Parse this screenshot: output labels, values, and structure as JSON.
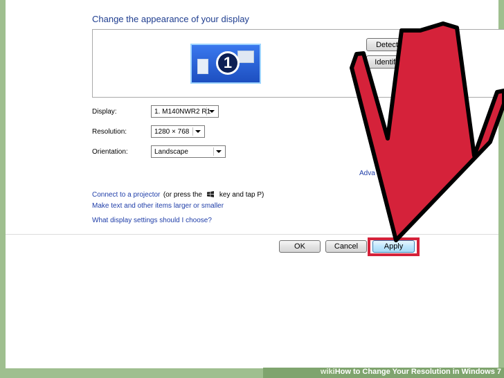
{
  "dialog": {
    "heading": "Change the appearance of your display",
    "monitor_number": "1",
    "detect_label": "Detect",
    "identify_label": "Identify"
  },
  "settings": {
    "display_label": "Display:",
    "display_value": "1. M140NWR2 R1",
    "resolution_label": "Resolution:",
    "resolution_value": "1280 × 768",
    "orientation_label": "Orientation:",
    "orientation_value": "Landscape",
    "advanced_link": "Adva"
  },
  "links": {
    "connect_link": "Connect to a projector",
    "connect_suffix_a": "(or press the",
    "connect_suffix_b": "key and tap P)",
    "larger_link": "Make text and other items larger or smaller",
    "which_link": "What display settings should I choose?"
  },
  "buttons": {
    "ok_label": "OK",
    "cancel_label": "Cancel",
    "apply_label": "Apply"
  },
  "footer": {
    "brand_wiki": "wiki",
    "brand_how": "How",
    "title": " to Change Your Resolution in Windows 7"
  },
  "colors": {
    "arrow": "#d5223a",
    "highlight": "#d5223a",
    "link": "#1e3da8",
    "background": "#9fbf8f"
  }
}
